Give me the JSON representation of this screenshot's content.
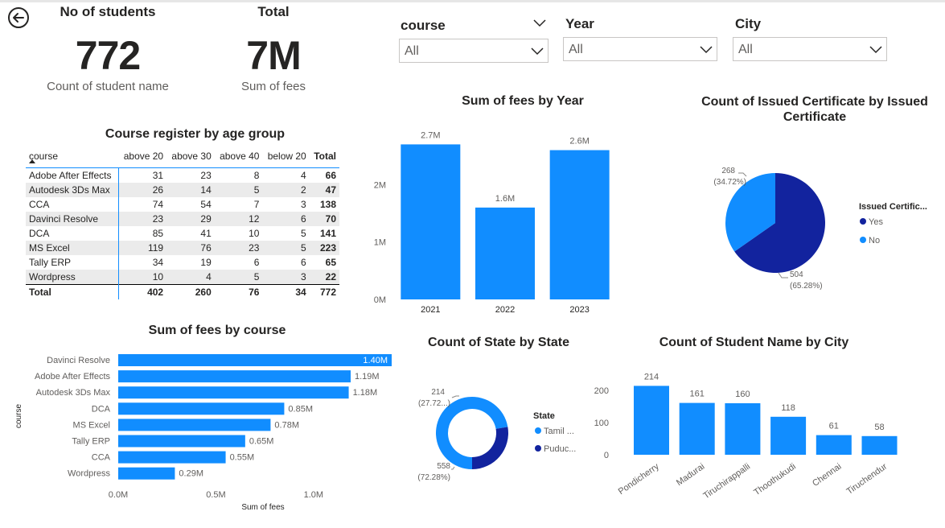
{
  "colors": {
    "accent": "#118dff",
    "dark": "#12239e",
    "text": "#252423",
    "muted": "#605e5c"
  },
  "cards": [
    {
      "title": "No of students",
      "value": "772",
      "sub": "Count of student name"
    },
    {
      "title": "Total",
      "value": "7M",
      "sub": "Sum of fees"
    }
  ],
  "slicers": [
    {
      "title": "course",
      "value": "All"
    },
    {
      "title": "Year",
      "value": "All"
    },
    {
      "title": "City",
      "value": "All"
    }
  ],
  "matrix": {
    "title": "Course register by age group",
    "headers": [
      "course",
      "above 20",
      "above 30",
      "above 40",
      "below 20",
      "Total"
    ],
    "rows": [
      [
        "Adobe After Effects",
        "31",
        "23",
        "8",
        "4",
        "66"
      ],
      [
        "Autodesk 3Ds Max",
        "26",
        "14",
        "5",
        "2",
        "47"
      ],
      [
        "CCA",
        "74",
        "54",
        "7",
        "3",
        "138"
      ],
      [
        "Davinci Resolve",
        "23",
        "29",
        "12",
        "6",
        "70"
      ],
      [
        "DCA",
        "85",
        "41",
        "10",
        "5",
        "141"
      ],
      [
        "MS Excel",
        "119",
        "76",
        "23",
        "5",
        "223"
      ],
      [
        "Tally ERP",
        "34",
        "19",
        "6",
        "6",
        "65"
      ],
      [
        "Wordpress",
        "10",
        "4",
        "5",
        "3",
        "22"
      ]
    ],
    "total": [
      "Total",
      "402",
      "260",
      "76",
      "34",
      "772"
    ]
  },
  "chart_data": [
    {
      "type": "bar",
      "title": "Sum of fees by Year",
      "categories": [
        "2021",
        "2022",
        "2023"
      ],
      "values": [
        2.7,
        1.6,
        2.6
      ],
      "data_labels": [
        "2.7M",
        "1.6M",
        "2.6M"
      ],
      "y_ticks": [
        "0M",
        "1M",
        "2M"
      ],
      "ylim": [
        0,
        3
      ],
      "unit": "M"
    },
    {
      "type": "pie",
      "title": "Count of Issued Certificate by Issued Certificate",
      "legend_title": "Issued Certific...",
      "slices": [
        {
          "name": "Yes",
          "value": 504,
          "label": "504",
          "pct": "(65.28%)",
          "color": "#12239e"
        },
        {
          "name": "No",
          "value": 268,
          "label": "268",
          "pct": "(34.72%)",
          "color": "#118dff"
        }
      ]
    },
    {
      "type": "bar",
      "orientation": "horizontal",
      "title": "Sum of fees by course",
      "xlabel": "Sum of fees",
      "ylabel": "course",
      "categories": [
        "Davinci Resolve",
        "Adobe After Effects",
        "Autodesk 3Ds Max",
        "DCA",
        "MS Excel",
        "Tally ERP",
        "CCA",
        "Wordpress"
      ],
      "values": [
        1.4,
        1.19,
        1.18,
        0.85,
        0.78,
        0.65,
        0.55,
        0.29
      ],
      "data_labels": [
        "1.40M",
        "1.19M",
        "1.18M",
        "0.85M",
        "0.78M",
        "0.65M",
        "0.55M",
        "0.29M"
      ],
      "x_ticks": [
        "0.0M",
        "0.5M",
        "1.0M"
      ],
      "xlim": [
        0,
        1.4
      ]
    },
    {
      "type": "pie",
      "donut": true,
      "title": "Count of State by State",
      "legend_title": "State",
      "slices": [
        {
          "name": "Tamil ...",
          "value": 558,
          "label": "558",
          "pct": "(72.28%)",
          "color": "#118dff"
        },
        {
          "name": "Puduc...",
          "value": 214,
          "label": "214",
          "pct": "(27.72...)",
          "color": "#12239e"
        }
      ]
    },
    {
      "type": "bar",
      "title": "Count of Student Name by City",
      "categories": [
        "Pondicherry",
        "Madurai",
        "Tiruchirappalli",
        "Thoothukudi",
        "Chennai",
        "Tiruchendur"
      ],
      "values": [
        214,
        161,
        160,
        118,
        61,
        58
      ],
      "data_labels": [
        "214",
        "161",
        "160",
        "118",
        "61",
        "58"
      ],
      "y_ticks": [
        "0",
        "100",
        "200"
      ],
      "ylim": [
        0,
        230
      ]
    }
  ]
}
